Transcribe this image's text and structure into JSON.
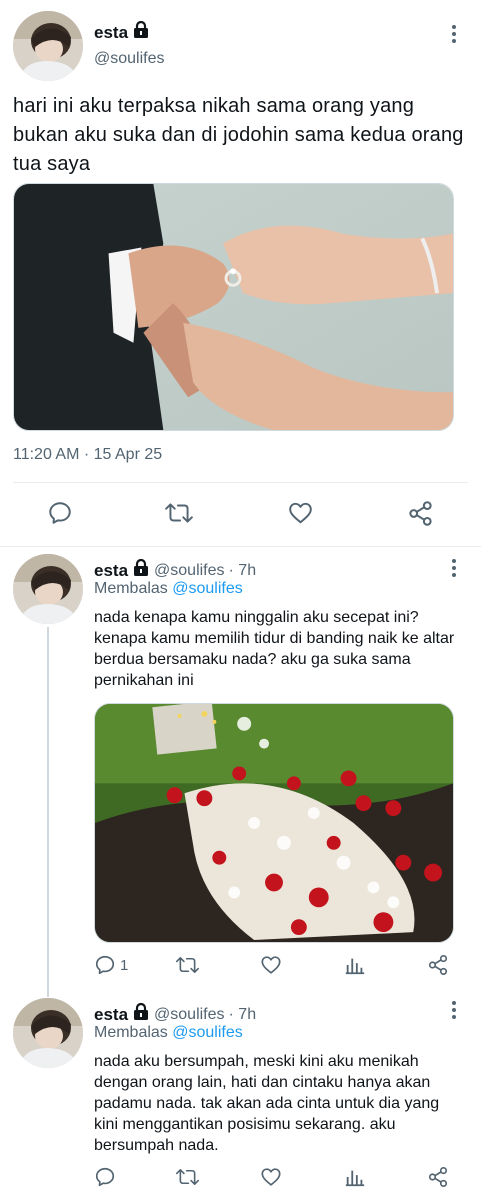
{
  "main_tweet": {
    "author_name": "esta",
    "handle": "@soulifes",
    "text": "hari ini aku terpaksa nikah sama orang yang bukan aku suka dan di jodohin sama kedua orang tua saya",
    "timestamp": "11:20 AM · 15 Apr 25",
    "image": "wedding-ring-hands-photo"
  },
  "replies": [
    {
      "author_name": "esta",
      "handle": "@soulifes",
      "time": "· 7h",
      "replying_label": "Membalas",
      "replying_to": "@soulifes",
      "text": "nada kenapa kamu ninggalin aku secepat ini? kenapa kamu memilih tidur di banding naik ke altar berdua bersamaku nada? aku ga suka sama pernikahan ini",
      "image": "grave-with-roses-photo",
      "reply_count": "1"
    },
    {
      "author_name": "esta",
      "handle": "@soulifes",
      "time": "· 7h",
      "replying_label": "Membalas",
      "replying_to": "@soulifes",
      "text": "nada aku bersumpah, meski kini aku menikah dengan orang lain, hati dan cintaku hanya akan padamu nada. tak akan ada cinta untuk dia yang kini menggantikan posisimu sekarang. aku bersumpah nada.",
      "reply_count": ""
    }
  ],
  "icons": {
    "reply": "reply-icon",
    "retweet": "retweet-icon",
    "like": "heart-icon",
    "analytics": "analytics-icon",
    "share": "share-icon",
    "more": "more-icon",
    "protected": "lock-icon"
  },
  "colors": {
    "text": "#0f1419",
    "secondary": "#536471",
    "link": "#1d9bf0",
    "divider": "#e6ecf0"
  }
}
